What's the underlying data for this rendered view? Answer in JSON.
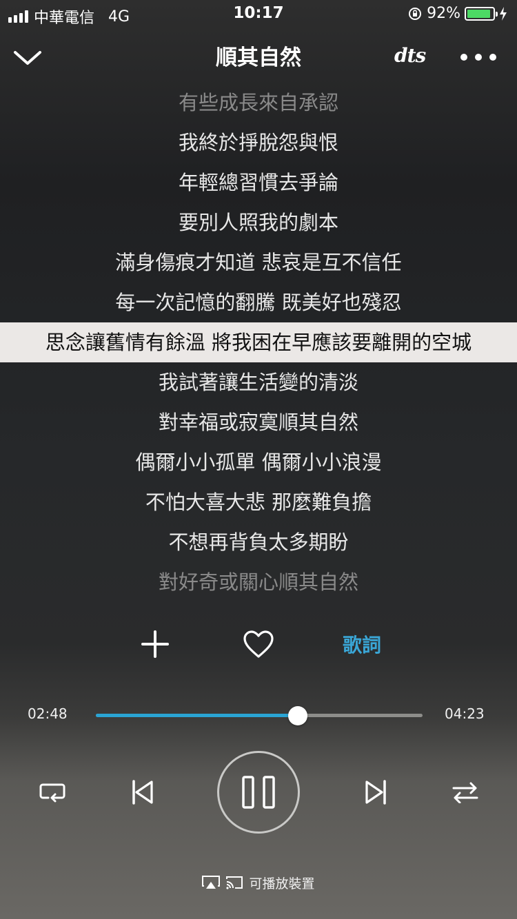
{
  "status_bar": {
    "carrier": "中華電信",
    "network": "4G",
    "time": "10:17",
    "battery": "92%",
    "battery_color": "#4cd964"
  },
  "nav": {
    "title": "順其自然",
    "dts_label": "dts"
  },
  "lyrics": [
    {
      "text": "有些成長來自承認",
      "state": "dim"
    },
    {
      "text": "我終於掙脫怨與恨",
      "state": "normal"
    },
    {
      "text": "年輕總習慣去爭論",
      "state": "normal"
    },
    {
      "text": "要別人照我的劇本",
      "state": "normal"
    },
    {
      "text": "滿身傷痕才知道 悲哀是互不信任",
      "state": "normal"
    },
    {
      "text": "每一次記憶的翻騰 既美好也殘忍",
      "state": "normal"
    },
    {
      "text": "思念讓舊情有餘溫 將我困在早應該要離開的空城",
      "state": "active"
    },
    {
      "text": "我試著讓生活變的清淡",
      "state": "normal"
    },
    {
      "text": "對幸福或寂寞順其自然",
      "state": "normal"
    },
    {
      "text": "偶爾小小孤單 偶爾小小浪漫",
      "state": "normal"
    },
    {
      "text": "不怕大喜大悲 那麼難負擔",
      "state": "normal"
    },
    {
      "text": "不想再背負太多期盼",
      "state": "normal"
    },
    {
      "text": "對好奇或關心順其自然",
      "state": "dim"
    }
  ],
  "actions": {
    "add_icon": "plus-icon",
    "favorite_icon": "heart-icon",
    "lyrics_label": "歌詞"
  },
  "player": {
    "elapsed": "02:48",
    "duration": "04:23",
    "progress_fraction": 0.619,
    "accent_color": "#2aa4d4"
  },
  "controls": {
    "repeat_icon": "repeat-icon",
    "prev_icon": "previous-icon",
    "pause_icon": "pause-icon",
    "next_icon": "next-icon",
    "shuffle_icon": "shuffle-icon"
  },
  "device": {
    "label": "可播放裝置"
  }
}
